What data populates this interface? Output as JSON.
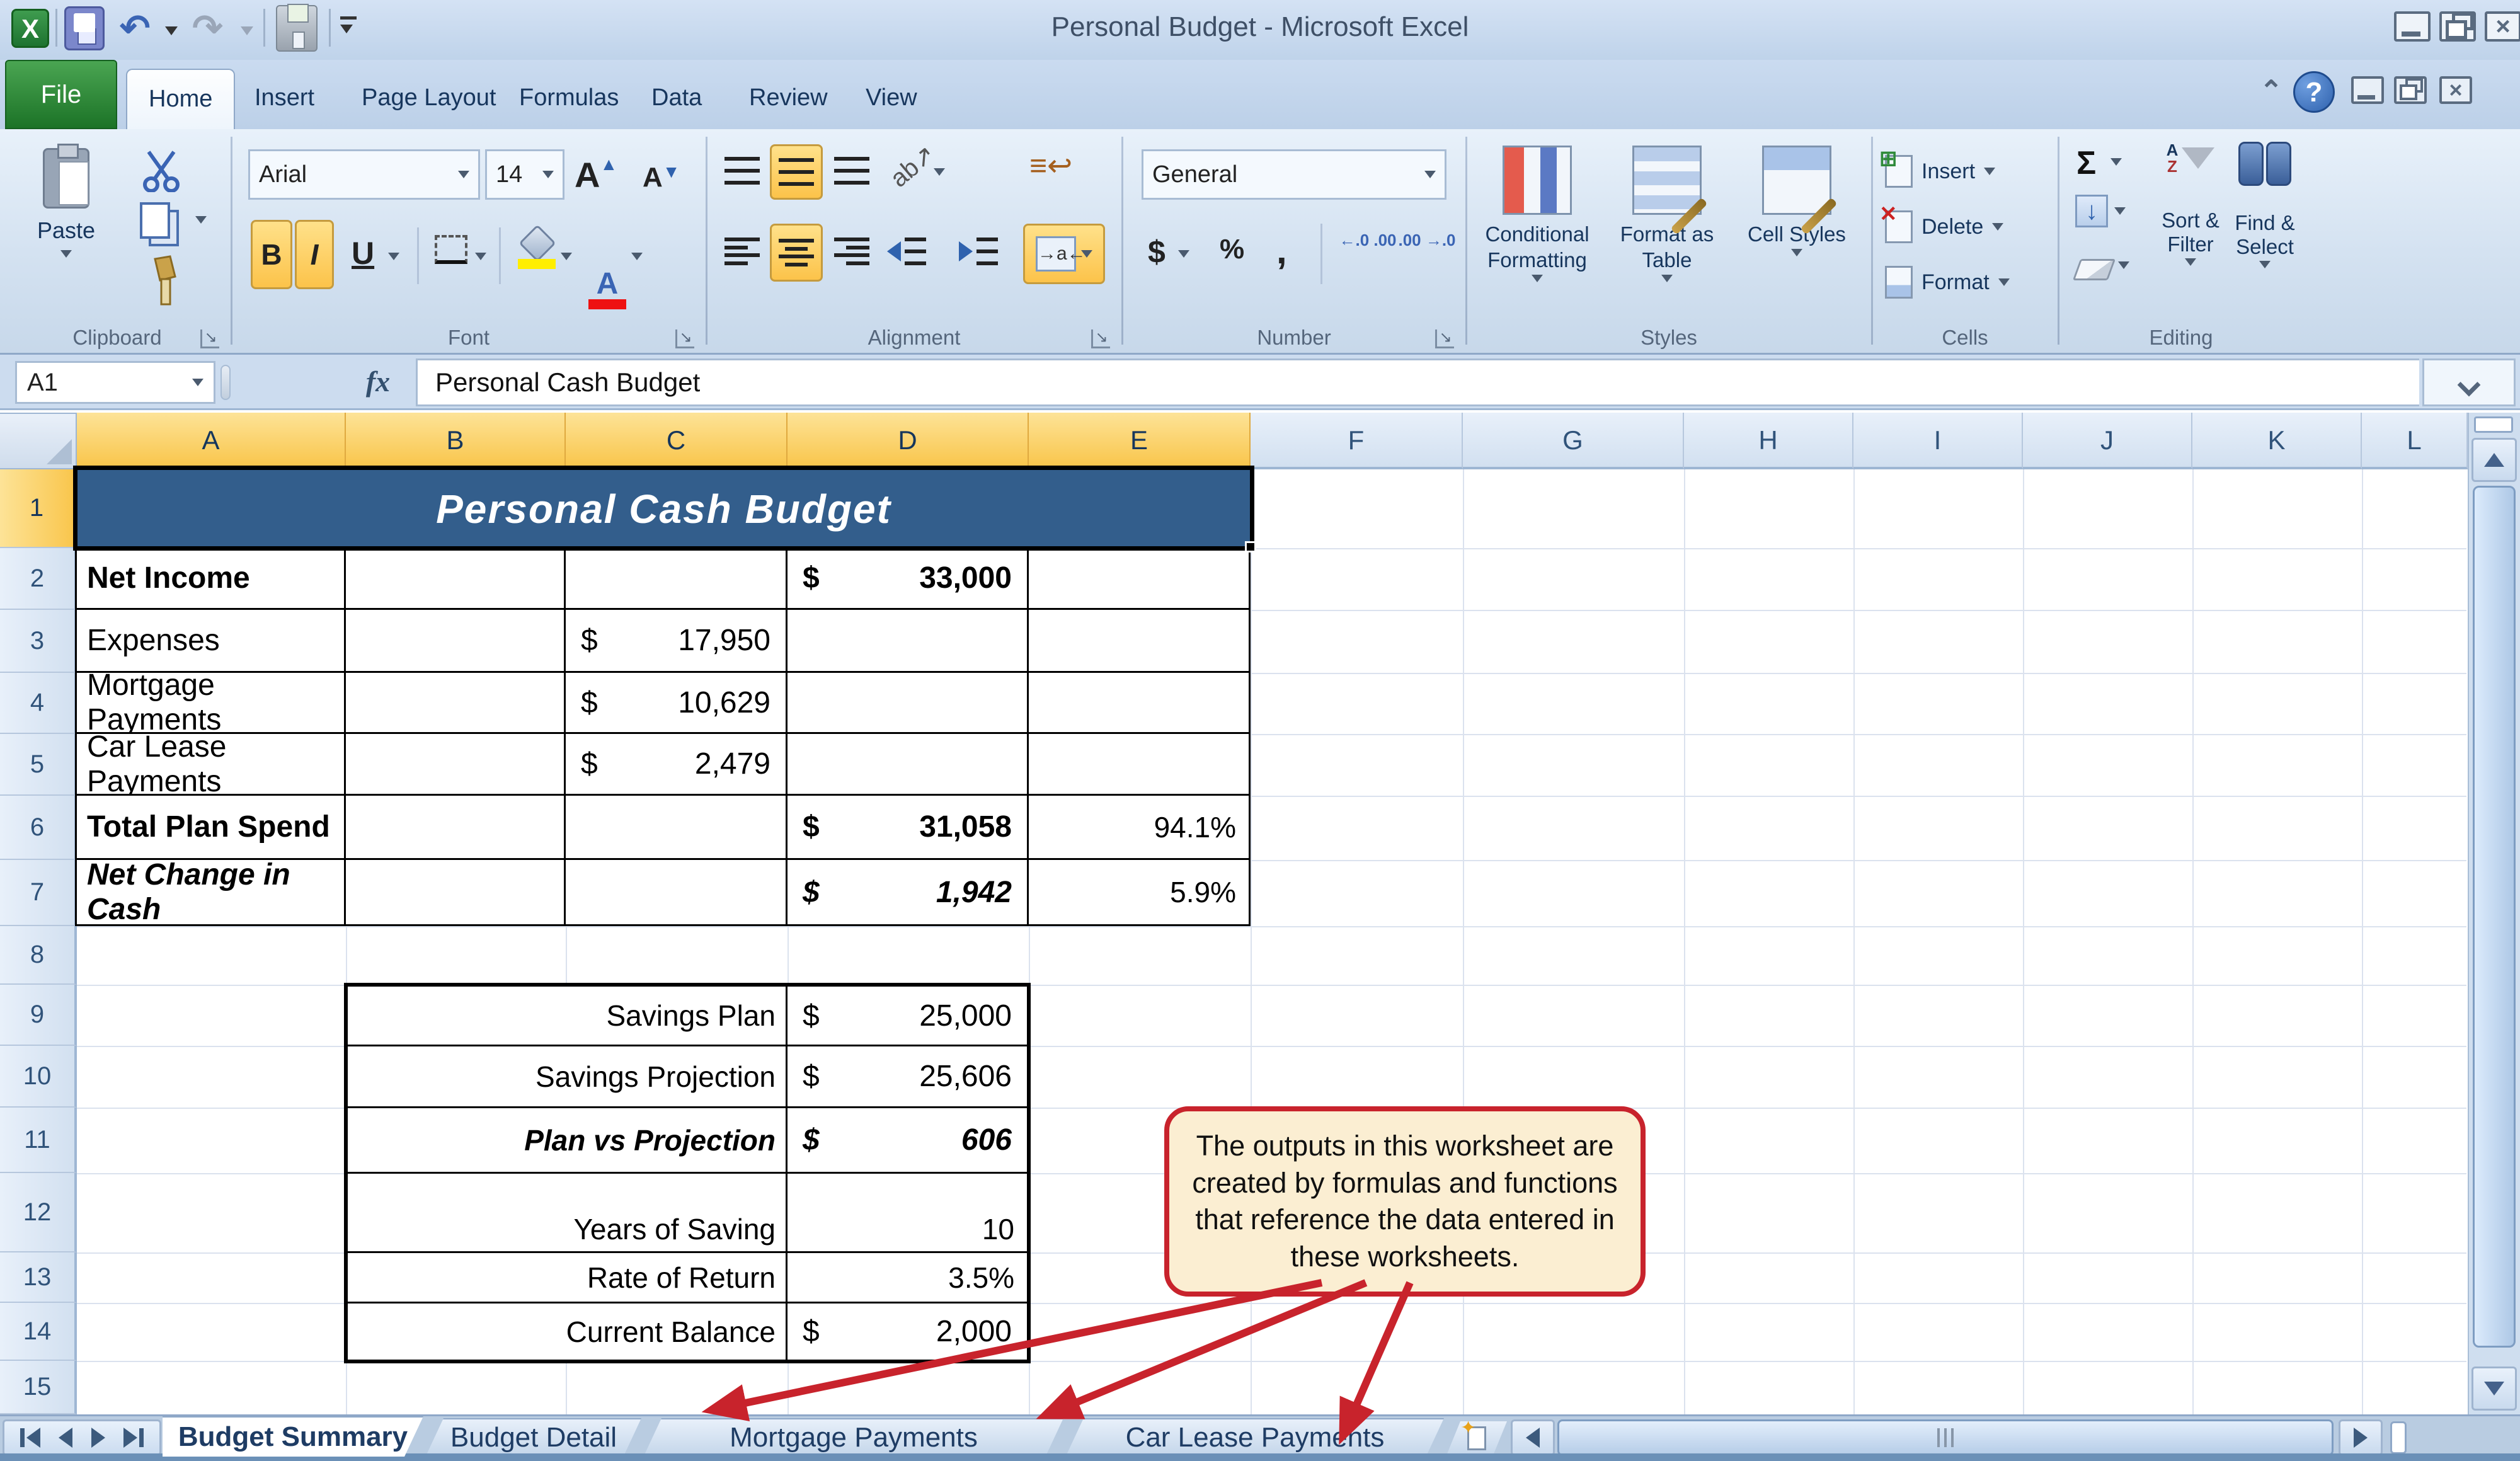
{
  "window": {
    "title": "Personal Budget  -  Microsoft Excel"
  },
  "ribbon_tabs": [
    {
      "label": "File"
    },
    {
      "label": "Home"
    },
    {
      "label": "Insert"
    },
    {
      "label": "Page Layout"
    },
    {
      "label": "Formulas"
    },
    {
      "label": "Data"
    },
    {
      "label": "Review"
    },
    {
      "label": "View"
    }
  ],
  "ribbon": {
    "clipboard": {
      "label": "Clipboard",
      "paste": "Paste"
    },
    "font": {
      "label": "Font",
      "name": "Arial",
      "size": "14",
      "bold": "B",
      "italic": "I",
      "underline": "U"
    },
    "alignment": {
      "label": "Alignment"
    },
    "number": {
      "label": "Number",
      "format": "General",
      "dollar": "$",
      "percent": "%",
      "comma": ",",
      "increase_decimal": "←.0 .00",
      "decrease_decimal": ".00 →.0"
    },
    "styles": {
      "label": "Styles",
      "conditional": "Conditional Formatting",
      "format_as_table": "Format as Table",
      "cell_styles": "Cell Styles"
    },
    "cells": {
      "label": "Cells",
      "insert": "Insert",
      "delete": "Delete",
      "format": "Format"
    },
    "editing": {
      "label": "Editing",
      "autosum": "Σ",
      "sort_filter": "Sort & Filter",
      "find_select": "Find & Select"
    }
  },
  "formula_bar": {
    "name_box": "A1",
    "fx": "fx",
    "formula": "Personal Cash Budget"
  },
  "columns": [
    "A",
    "B",
    "C",
    "D",
    "E",
    "F",
    "G",
    "H",
    "I",
    "J",
    "K",
    "L"
  ],
  "rows": [
    "1",
    "2",
    "3",
    "4",
    "5",
    "6",
    "7",
    "8",
    "9",
    "10",
    "11",
    "12",
    "13",
    "14",
    "15"
  ],
  "title_cell": "Personal Cash Budget",
  "grid": {
    "a2": "Net Income",
    "d2_dollar": "$",
    "d2": "33,000",
    "a3": "Expenses",
    "c3_dollar": "$",
    "c3": "17,950",
    "a4": "Mortgage Payments",
    "c4_dollar": "$",
    "c4": "10,629",
    "a5": "Car Lease Payments",
    "c5_dollar": "$",
    "c5": "2,479",
    "a6": "Total Plan Spend",
    "d6_dollar": "$",
    "d6": "31,058",
    "e6": "94.1%",
    "a7": "Net Change in Cash",
    "d7_dollar": "$",
    "d7": "1,942",
    "e7": "5.9%"
  },
  "savings": {
    "r9_label": "Savings Plan",
    "r9_dollar": "$",
    "r9": "25,000",
    "r10_label": "Savings Projection",
    "r10_dollar": "$",
    "r10": "25,606",
    "r11_label": "Plan vs Projection",
    "r11_dollar": "$",
    "r11": "606",
    "r12_label": "Years of Saving",
    "r12": "10",
    "r13_label": "Rate of Return",
    "r13": "3.5%",
    "r14_label": "Current Balance",
    "r14_dollar": "$",
    "r14": "2,000"
  },
  "callout": {
    "text": "The outputs in this worksheet are created by formulas and functions that reference the data entered in these worksheets."
  },
  "sheet_tabs": [
    {
      "label": "Budget Summary"
    },
    {
      "label": "Budget Detail"
    },
    {
      "label": "Mortgage Payments"
    },
    {
      "label": "Car Lease Payments"
    }
  ],
  "colors": {
    "selection_header": "#f9c64d",
    "title_fill": "#335e8c",
    "callout_bg": "#fbeed2",
    "callout_border": "#c8232c",
    "arrow": "#c8232c"
  }
}
